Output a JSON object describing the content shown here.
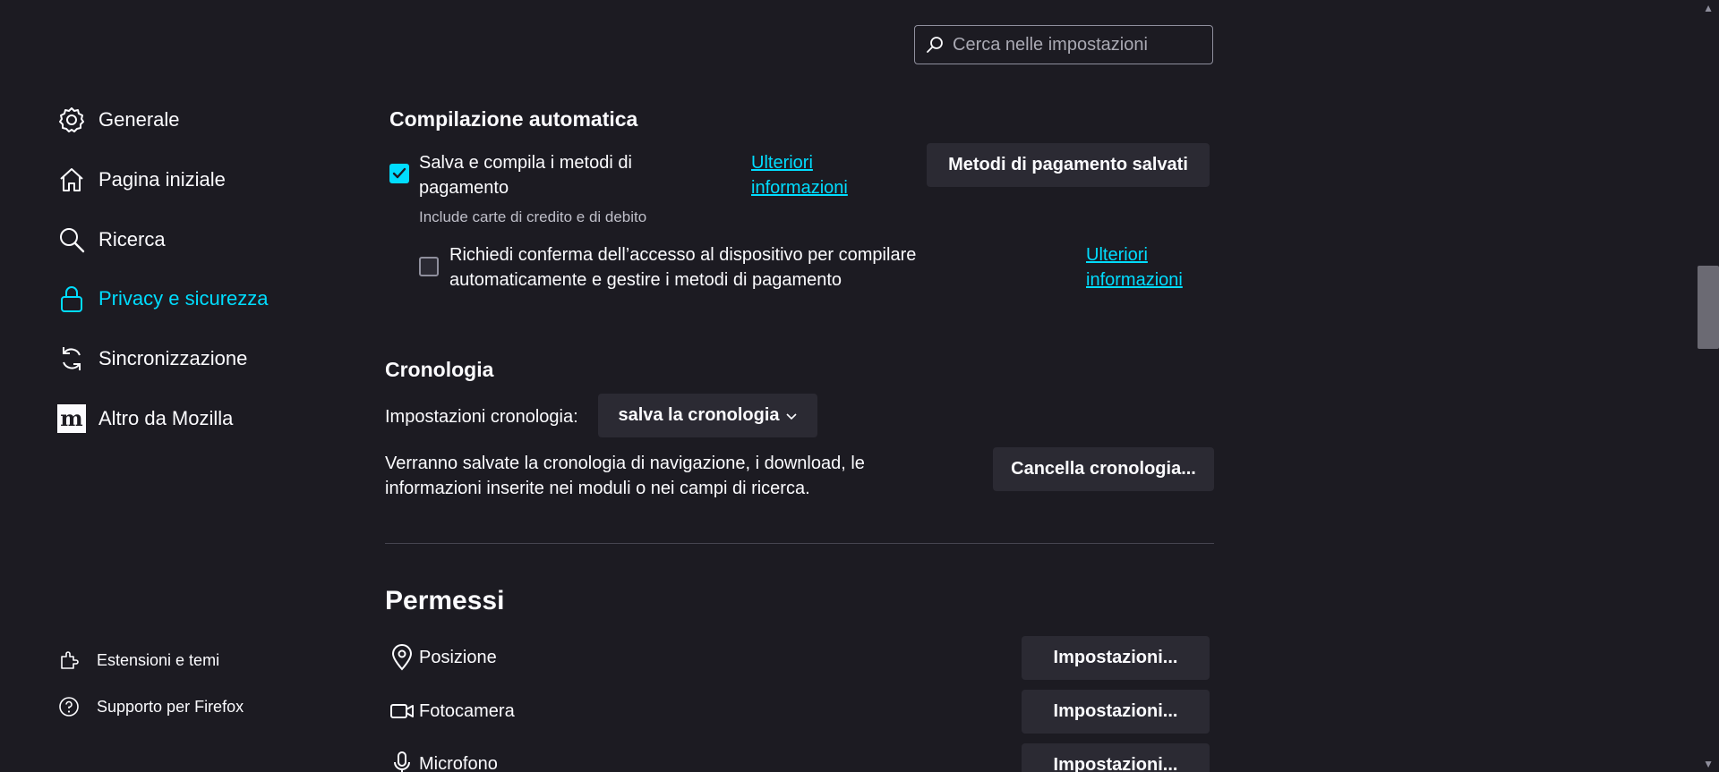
{
  "search": {
    "placeholder": "Cerca nelle impostazioni"
  },
  "sidebar": {
    "items": [
      {
        "label": "Generale",
        "icon": "gear-icon"
      },
      {
        "label": "Pagina iniziale",
        "icon": "home-icon"
      },
      {
        "label": "Ricerca",
        "icon": "search-icon"
      },
      {
        "label": "Privacy e sicurezza",
        "icon": "lock-icon",
        "active": true
      },
      {
        "label": "Sincronizzazione",
        "icon": "sync-icon"
      },
      {
        "label": "Altro da Mozilla",
        "icon": "mozilla-icon"
      }
    ],
    "footer": [
      {
        "label": "Estensioni e temi",
        "icon": "puzzle-icon"
      },
      {
        "label": "Supporto per Firefox",
        "icon": "help-icon"
      }
    ]
  },
  "autofill": {
    "heading": "Compilazione automatica",
    "save_payment_line1": "Salva e compila i metodi di",
    "save_payment_line2": "pagamento",
    "save_payment_checked": true,
    "save_payment_sub": "Include carte di credito e di debito",
    "learn_more_line1": "Ulteriori",
    "learn_more_line2": "informazioni",
    "saved_methods_button": "Metodi di pagamento salvati",
    "require_auth_line1": "Richiedi conferma dell’accesso al dispositivo per compilare",
    "require_auth_line2": "automaticamente e gestire i metodi di pagamento",
    "require_auth_checked": false
  },
  "history": {
    "heading": "Cronologia",
    "settings_label": "Impostazioni cronologia:",
    "settings_value": "salva la cronologia",
    "description_line1": "Verranno salvate la cronologia di navigazione, i download, le",
    "description_line2": "informazioni inserite nei moduli o nei campi di ricerca.",
    "clear_button": "Cancella cronologia..."
  },
  "permissions": {
    "heading": "Permessi",
    "items": [
      {
        "label": "Posizione",
        "icon": "location-pin-icon",
        "button": "Impostazioni..."
      },
      {
        "label": "Fotocamera",
        "icon": "camera-icon",
        "button": "Impostazioni..."
      },
      {
        "label": "Microfono",
        "icon": "microphone-icon",
        "button": "Impostazioni..."
      }
    ]
  },
  "colors": {
    "background": "#1c1b22",
    "accent": "#00ddff",
    "button": "#2b2a33"
  }
}
